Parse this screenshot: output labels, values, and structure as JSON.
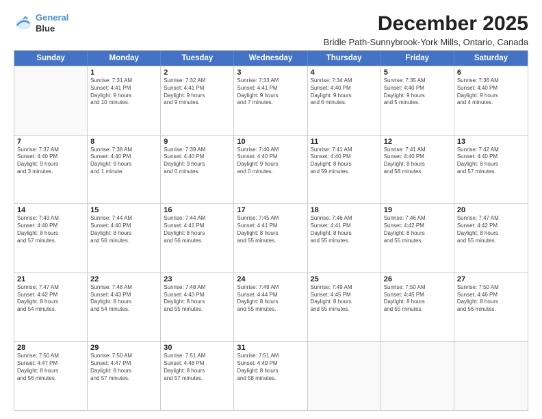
{
  "header": {
    "logo_line1": "General",
    "logo_line2": "Blue",
    "title": "December 2025",
    "subtitle": "Bridle Path-Sunnybrook-York Mills, Ontario, Canada"
  },
  "calendar": {
    "days": [
      "Sunday",
      "Monday",
      "Tuesday",
      "Wednesday",
      "Thursday",
      "Friday",
      "Saturday"
    ],
    "rows": [
      [
        {
          "day": "",
          "lines": []
        },
        {
          "day": "1",
          "lines": [
            "Sunrise: 7:31 AM",
            "Sunset: 4:41 PM",
            "Daylight: 9 hours",
            "and 10 minutes."
          ]
        },
        {
          "day": "2",
          "lines": [
            "Sunrise: 7:32 AM",
            "Sunset: 4:41 PM",
            "Daylight: 9 hours",
            "and 9 minutes."
          ]
        },
        {
          "day": "3",
          "lines": [
            "Sunrise: 7:33 AM",
            "Sunset: 4:41 PM",
            "Daylight: 9 hours",
            "and 7 minutes."
          ]
        },
        {
          "day": "4",
          "lines": [
            "Sunrise: 7:34 AM",
            "Sunset: 4:40 PM",
            "Daylight: 9 hours",
            "and 6 minutes."
          ]
        },
        {
          "day": "5",
          "lines": [
            "Sunrise: 7:35 AM",
            "Sunset: 4:40 PM",
            "Daylight: 9 hours",
            "and 5 minutes."
          ]
        },
        {
          "day": "6",
          "lines": [
            "Sunrise: 7:36 AM",
            "Sunset: 4:40 PM",
            "Daylight: 9 hours",
            "and 4 minutes."
          ]
        }
      ],
      [
        {
          "day": "7",
          "lines": [
            "Sunrise: 7:37 AM",
            "Sunset: 4:40 PM",
            "Daylight: 9 hours",
            "and 3 minutes."
          ]
        },
        {
          "day": "8",
          "lines": [
            "Sunrise: 7:38 AM",
            "Sunset: 4:40 PM",
            "Daylight: 9 hours",
            "and 1 minute."
          ]
        },
        {
          "day": "9",
          "lines": [
            "Sunrise: 7:39 AM",
            "Sunset: 4:40 PM",
            "Daylight: 9 hours",
            "and 0 minutes."
          ]
        },
        {
          "day": "10",
          "lines": [
            "Sunrise: 7:40 AM",
            "Sunset: 4:40 PM",
            "Daylight: 9 hours",
            "and 0 minutes."
          ]
        },
        {
          "day": "11",
          "lines": [
            "Sunrise: 7:41 AM",
            "Sunset: 4:40 PM",
            "Daylight: 8 hours",
            "and 59 minutes."
          ]
        },
        {
          "day": "12",
          "lines": [
            "Sunrise: 7:41 AM",
            "Sunset: 4:40 PM",
            "Daylight: 8 hours",
            "and 58 minutes."
          ]
        },
        {
          "day": "13",
          "lines": [
            "Sunrise: 7:42 AM",
            "Sunset: 4:40 PM",
            "Daylight: 8 hours",
            "and 57 minutes."
          ]
        }
      ],
      [
        {
          "day": "14",
          "lines": [
            "Sunrise: 7:43 AM",
            "Sunset: 4:40 PM",
            "Daylight: 8 hours",
            "and 57 minutes."
          ]
        },
        {
          "day": "15",
          "lines": [
            "Sunrise: 7:44 AM",
            "Sunset: 4:40 PM",
            "Daylight: 8 hours",
            "and 56 minutes."
          ]
        },
        {
          "day": "16",
          "lines": [
            "Sunrise: 7:44 AM",
            "Sunset: 4:41 PM",
            "Daylight: 8 hours",
            "and 56 minutes."
          ]
        },
        {
          "day": "17",
          "lines": [
            "Sunrise: 7:45 AM",
            "Sunset: 4:41 PM",
            "Daylight: 8 hours",
            "and 55 minutes."
          ]
        },
        {
          "day": "18",
          "lines": [
            "Sunrise: 7:46 AM",
            "Sunset: 4:41 PM",
            "Daylight: 8 hours",
            "and 55 minutes."
          ]
        },
        {
          "day": "19",
          "lines": [
            "Sunrise: 7:46 AM",
            "Sunset: 4:42 PM",
            "Daylight: 8 hours",
            "and 55 minutes."
          ]
        },
        {
          "day": "20",
          "lines": [
            "Sunrise: 7:47 AM",
            "Sunset: 4:42 PM",
            "Daylight: 8 hours",
            "and 55 minutes."
          ]
        }
      ],
      [
        {
          "day": "21",
          "lines": [
            "Sunrise: 7:47 AM",
            "Sunset: 4:42 PM",
            "Daylight: 8 hours",
            "and 54 minutes."
          ]
        },
        {
          "day": "22",
          "lines": [
            "Sunrise: 7:48 AM",
            "Sunset: 4:43 PM",
            "Daylight: 8 hours",
            "and 54 minutes."
          ]
        },
        {
          "day": "23",
          "lines": [
            "Sunrise: 7:48 AM",
            "Sunset: 4:43 PM",
            "Daylight: 8 hours",
            "and 55 minutes."
          ]
        },
        {
          "day": "24",
          "lines": [
            "Sunrise: 7:49 AM",
            "Sunset: 4:44 PM",
            "Daylight: 8 hours",
            "and 55 minutes."
          ]
        },
        {
          "day": "25",
          "lines": [
            "Sunrise: 7:49 AM",
            "Sunset: 4:45 PM",
            "Daylight: 8 hours",
            "and 55 minutes."
          ]
        },
        {
          "day": "26",
          "lines": [
            "Sunrise: 7:50 AM",
            "Sunset: 4:45 PM",
            "Daylight: 8 hours",
            "and 55 minutes."
          ]
        },
        {
          "day": "27",
          "lines": [
            "Sunrise: 7:50 AM",
            "Sunset: 4:46 PM",
            "Daylight: 8 hours",
            "and 56 minutes."
          ]
        }
      ],
      [
        {
          "day": "28",
          "lines": [
            "Sunrise: 7:50 AM",
            "Sunset: 4:47 PM",
            "Daylight: 8 hours",
            "and 56 minutes."
          ]
        },
        {
          "day": "29",
          "lines": [
            "Sunrise: 7:50 AM",
            "Sunset: 4:47 PM",
            "Daylight: 8 hours",
            "and 57 minutes."
          ]
        },
        {
          "day": "30",
          "lines": [
            "Sunrise: 7:51 AM",
            "Sunset: 4:48 PM",
            "Daylight: 8 hours",
            "and 57 minutes."
          ]
        },
        {
          "day": "31",
          "lines": [
            "Sunrise: 7:51 AM",
            "Sunset: 4:49 PM",
            "Daylight: 8 hours",
            "and 58 minutes."
          ]
        },
        {
          "day": "",
          "lines": []
        },
        {
          "day": "",
          "lines": []
        },
        {
          "day": "",
          "lines": []
        }
      ]
    ]
  }
}
